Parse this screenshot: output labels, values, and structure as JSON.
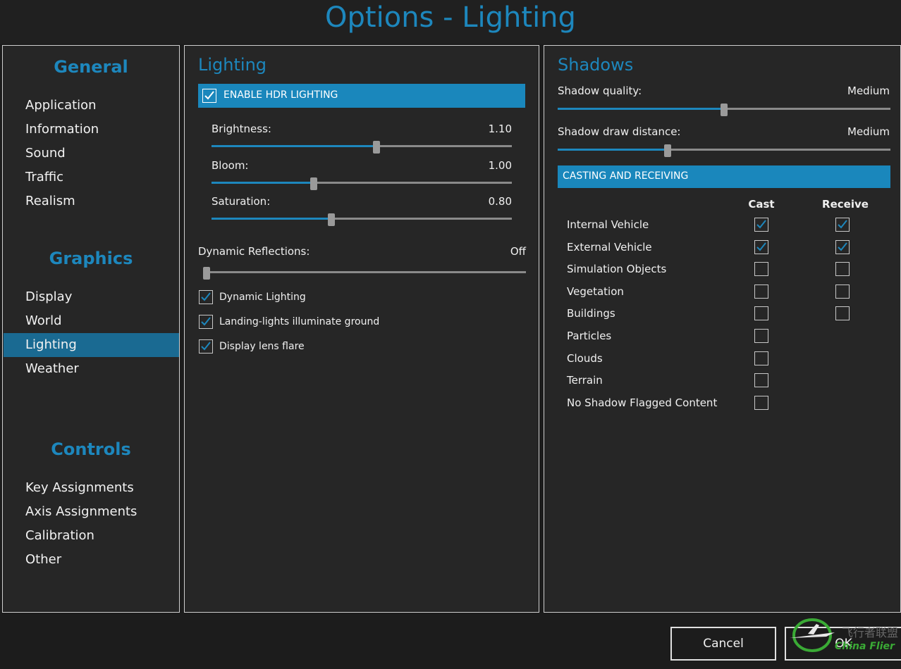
{
  "window": {
    "title": "Options - Lighting"
  },
  "nav": {
    "sections": [
      {
        "title": "General",
        "items": [
          "Application",
          "Information",
          "Sound",
          "Traffic",
          "Realism"
        ]
      },
      {
        "title": "Graphics",
        "items": [
          "Display",
          "World",
          "Lighting",
          "Weather"
        ]
      },
      {
        "title": "Controls",
        "items": [
          "Key Assignments",
          "Axis Assignments",
          "Calibration",
          "Other"
        ]
      }
    ],
    "active": "Lighting"
  },
  "lighting": {
    "title": "Lighting",
    "hdr": {
      "label": "ENABLE HDR LIGHTING",
      "checked": true
    },
    "sliders": [
      {
        "label": "Brightness:",
        "value": "1.10",
        "fraction": 0.55
      },
      {
        "label": "Bloom:",
        "value": "1.00",
        "fraction": 0.34
      },
      {
        "label": "Saturation:",
        "value": "0.80",
        "fraction": 0.4
      }
    ],
    "reflections": {
      "label": "Dynamic Reflections:",
      "value": "Off",
      "fraction": 0.0
    },
    "checkboxes": [
      {
        "label": "Dynamic Lighting",
        "checked": true
      },
      {
        "label": "Landing-lights illuminate ground",
        "checked": true
      },
      {
        "label": "Display lens flare",
        "checked": true
      }
    ]
  },
  "shadows": {
    "title": "Shadows",
    "quality": {
      "label": "Shadow quality:",
      "value": "Medium",
      "fraction": 0.5
    },
    "distance": {
      "label": "Shadow draw distance:",
      "value": "Medium",
      "fraction": 0.33
    },
    "casting": {
      "title": "CASTING AND RECEIVING",
      "cast_label": "Cast",
      "receive_label": "Receive",
      "rows": [
        {
          "label": "Internal Vehicle",
          "cast": true,
          "receive": true
        },
        {
          "label": "External Vehicle",
          "cast": true,
          "receive": true
        },
        {
          "label": "Simulation Objects",
          "cast": false,
          "receive": false
        },
        {
          "label": "Vegetation",
          "cast": false,
          "receive": false
        },
        {
          "label": "Buildings",
          "cast": false,
          "receive": false
        },
        {
          "label": "Particles",
          "cast": false,
          "receive": null
        },
        {
          "label": "Clouds",
          "cast": false,
          "receive": null
        },
        {
          "label": "Terrain",
          "cast": false,
          "receive": null
        },
        {
          "label": "No Shadow Flagged Content",
          "cast": false,
          "receive": null
        }
      ]
    }
  },
  "buttons": {
    "cancel": "Cancel",
    "ok": "OK"
  },
  "watermark": {
    "text": "飞行者联盟",
    "subtext": "China Flier"
  },
  "colors": {
    "accent": "#1d87bd",
    "selection": "#1a6a92",
    "panel": "#262626"
  }
}
